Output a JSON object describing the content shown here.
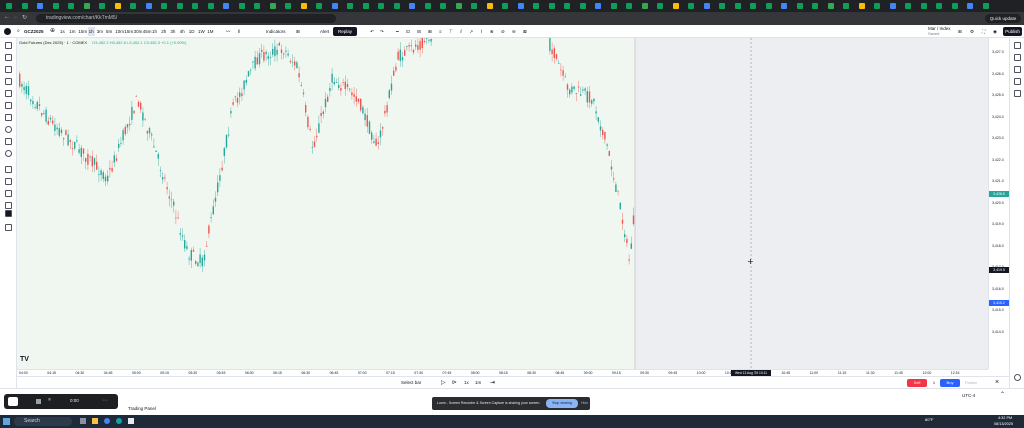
{
  "browser": {
    "url": "tradingview.com/chart/KkTmM5/",
    "quick_update_label": "Quick update",
    "tab_colors": [
      "#0f9d58",
      "#0f9d58",
      "#4285f4",
      "#0f9d58",
      "#0f9d58",
      "#34a853",
      "#0f9d58",
      "#fbbc04",
      "#0f9d58",
      "#4285f4",
      "#0f9d58",
      "#0f9d58"
    ]
  },
  "toolbar": {
    "symbol": "GCZ2025",
    "intervals": [
      "1s",
      "1m",
      "15m",
      "1h",
      "3m",
      "5m",
      "10m",
      "15m",
      "30m",
      "45m",
      "1h",
      "2h",
      "3h",
      "4h",
      "1D",
      "1W",
      "1M"
    ],
    "active_interval": "1m",
    "indicators_label": "Indicators",
    "alert_label": "Alert",
    "replay_label": "Replay",
    "layout_name": "Mar / Index",
    "layout_sub": "Saved",
    "publish_label": "Publish"
  },
  "chart": {
    "legend_title": "Gold Futures (Dec 2025) · 1 · COMEX",
    "legend_values": "O3,452.2 H3,452.6 L3,452.1 C3,452.3 +0.1 (+0.00%)",
    "watermark": "TV",
    "price_labels": [
      "3,427.0",
      "3,426.0",
      "3,425.0",
      "3,424.0",
      "3,423.0",
      "3,422.0",
      "3,421.0",
      "3,420.0",
      "3,419.0",
      "3,418.0",
      "3,417.0",
      "3,416.0",
      "3,415.0",
      "3,414.0"
    ],
    "current_price": "3,428.5",
    "cursor_price": "3,419.5",
    "lower_price": "3,415.2",
    "time_labels": [
      "04:00",
      "04:15",
      "04:30",
      "04:45",
      "05:00",
      "05:15",
      "05:30",
      "05:45",
      "06:00",
      "06:15",
      "06:30",
      "06:45",
      "07:00",
      "07:15",
      "07:30",
      "07:45",
      "08:00",
      "08:15",
      "08:30",
      "08:45",
      "09:00",
      "09:15",
      "09:30",
      "09:45",
      "10:00",
      "10:15",
      "10:30",
      "10:45",
      "11:00",
      "11:15",
      "11:30",
      "11:45",
      "12:00",
      "12:15"
    ],
    "cursor_time": "Wed 13 Aug '25  10:11",
    "up_color": "#26a69a",
    "down_color": "#ef5350"
  },
  "replay": {
    "select_bar": "Select bar",
    "speed": "1x",
    "interval": "1m",
    "sell_label": "Sell",
    "buy_label": "Buy",
    "qty": "1",
    "flatten_label": "Flatten"
  },
  "bottom": {
    "trading_panel_label": "Trading Panel",
    "timezone": "UTC-4",
    "recording_time": "0:00"
  },
  "share_banner": {
    "message": "Loom - Screen Recorder & Screen Capture is sharing your screen.",
    "stop_label": "Stop sharing",
    "hide_label": "Hide"
  },
  "taskbar": {
    "search_placeholder": "Search",
    "weather": "80°F",
    "time": "4:32 PM",
    "date": "08/13/2025"
  }
}
